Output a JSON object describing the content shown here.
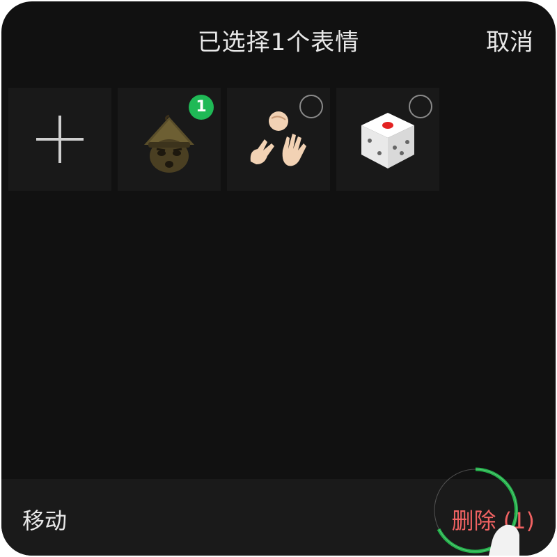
{
  "header": {
    "title": "已选择1个表情",
    "cancel_label": "取消"
  },
  "grid": {
    "items": [
      {
        "type": "add",
        "icon": "plus-icon"
      },
      {
        "type": "sticker",
        "icon": "straw-hat-face-sticker",
        "selected": true,
        "badge": "1"
      },
      {
        "type": "sticker",
        "icon": "rock-paper-scissors-sticker",
        "selected": false
      },
      {
        "type": "sticker",
        "icon": "dice-sticker",
        "selected": false
      }
    ]
  },
  "bottom_bar": {
    "move_label": "移动",
    "delete_label": "删除 (1)"
  },
  "colors": {
    "background": "#111111",
    "accent_green": "#1fb956",
    "delete_red": "#f06262"
  }
}
